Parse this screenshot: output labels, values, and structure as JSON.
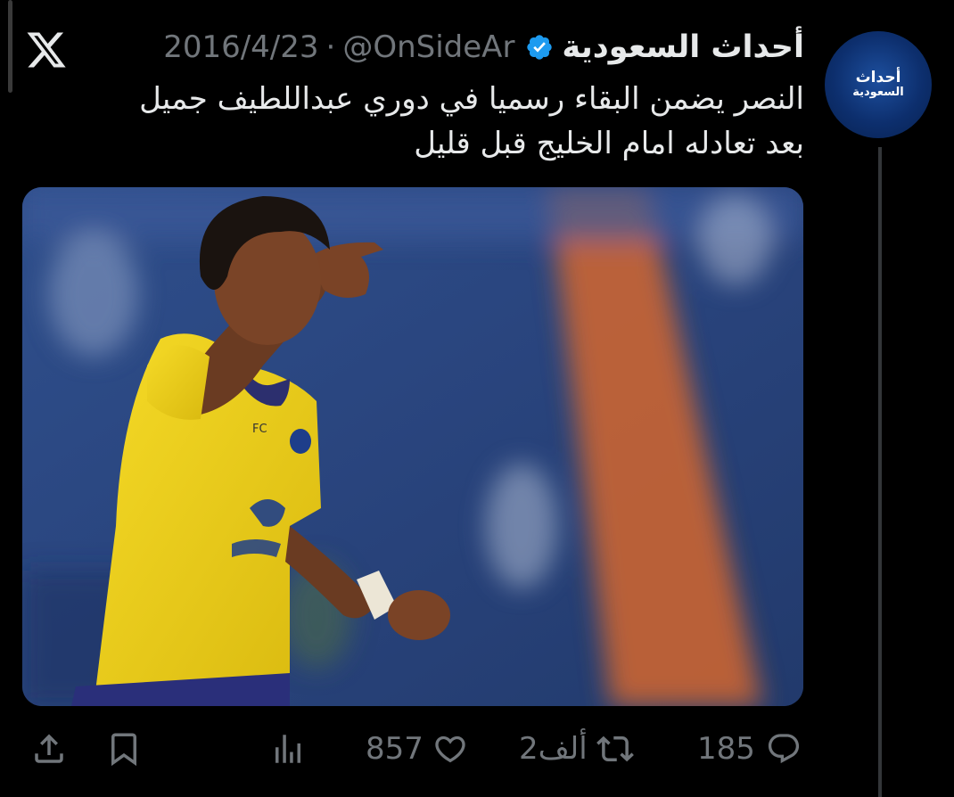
{
  "tweet": {
    "display_name": "أحداث السعودية",
    "handle": "@OnSideAr",
    "separator": "·",
    "date": "2016/4/23",
    "text_line1": "النصر يضمن البقاء رسميا في دوري عبداللطيف جميل",
    "text_line2": "بعد تعادله امام الخليج قبل قليل",
    "avatar_line1": "أحداث",
    "avatar_line2": "السعودية",
    "media_icon": "photo-soccer-player-pointing",
    "jersey_text": "FC"
  },
  "actions": {
    "replies": "185",
    "reposts": "2ألف",
    "likes": "857",
    "icons": [
      "reply-icon",
      "repost-icon",
      "like-icon",
      "views-icon",
      "bookmark-icon",
      "share-icon"
    ]
  },
  "colors": {
    "background": "#000000",
    "text": "#e7e9ea",
    "muted": "#71767b",
    "verified": "#1d9bf0",
    "jersey": "#f1d21c"
  }
}
